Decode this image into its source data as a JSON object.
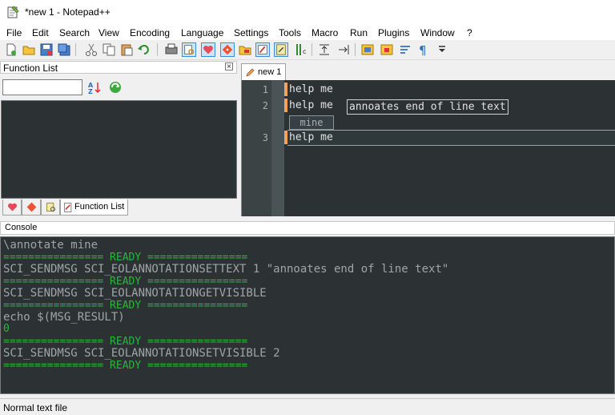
{
  "window": {
    "title": "*new 1 - Notepad++"
  },
  "menu": [
    "File",
    "Edit",
    "Search",
    "View",
    "Encoding",
    "Language",
    "Settings",
    "Tools",
    "Macro",
    "Run",
    "Plugins",
    "Window",
    "?"
  ],
  "toolbar": {
    "icons": [
      "new-file",
      "open-file",
      "save",
      "save-all",
      "close",
      "close-all",
      "print",
      "cut",
      "copy",
      "paste",
      "undo",
      "redo",
      "find",
      "replace",
      "zoom-in",
      "zoom-out",
      "sync-vertical",
      "sync-horizontal",
      "word-wrap",
      "show-all-characters",
      "indent-guide",
      "function-list",
      "document-map",
      "folder-as-workspace",
      "monitoring",
      "record-macro",
      "stop-recording",
      "play-macro",
      "run-macro-multiple",
      "save-macro",
      "dropdown"
    ]
  },
  "function_list": {
    "title": "Function List",
    "close_symbol": "×",
    "search_value": "",
    "search_placeholder": "",
    "items": [],
    "bottom_tabs": [
      {
        "icon": "heart-icon",
        "label": ""
      },
      {
        "icon": "git-icon",
        "label": ""
      },
      {
        "icon": "document-map-icon",
        "label": ""
      },
      {
        "icon": "function-list-icon",
        "label": "Function List"
      }
    ]
  },
  "editor": {
    "tabs": [
      {
        "label": "new 1",
        "modified": true
      }
    ],
    "lines": [
      {
        "number": "1",
        "text": "help me"
      },
      {
        "number": "2",
        "text": "help me",
        "eol_annotation": "annoates end of line text",
        "annotation": "mine"
      },
      {
        "number": "3",
        "text": "help me"
      }
    ]
  },
  "console": {
    "title": "Console",
    "lines": [
      {
        "text": "\\annotate mine",
        "style": "gray"
      },
      {
        "text": "================ READY ================",
        "style": "green"
      },
      {
        "text": "SCI_SENDMSG SCI_EOLANNOTATIONSETTEXT 1 \"annoates end of line text\"",
        "style": "gray"
      },
      {
        "text": "================ READY ================",
        "style": "green"
      },
      {
        "text": "SCI_SENDMSG SCI_EOLANNOTATIONGETVISIBLE",
        "style": "gray"
      },
      {
        "text": "================ READY ================",
        "style": "green"
      },
      {
        "text": "echo $(MSG_RESULT)",
        "style": "gray"
      },
      {
        "text": "0",
        "style": "green"
      },
      {
        "text": "================ READY ================",
        "style": "green"
      },
      {
        "text": "SCI_SENDMSG SCI_EOLANNOTATIONSETVISIBLE 2",
        "style": "gray"
      },
      {
        "text": "================ READY ================",
        "style": "green"
      }
    ]
  },
  "statusbar": {
    "text": "Normal text file"
  },
  "colors": {
    "editor_bg": "#2c3234",
    "gutter_bg": "#3b4345",
    "change_marker": "#f3a35a",
    "console_green": "#2bb53a",
    "console_gray": "#a0a4a6"
  }
}
